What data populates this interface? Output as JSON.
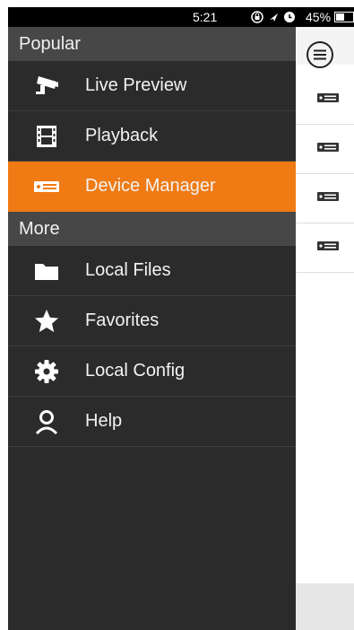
{
  "status_bar": {
    "time": "5:21",
    "battery_percent": "45%",
    "battery_level": 0.45,
    "icons": [
      "lock-rotation-icon",
      "location-arrow-icon",
      "alarm-icon",
      "battery-icon"
    ]
  },
  "drawer": {
    "sections": [
      {
        "header": "Popular",
        "items": [
          {
            "label": "Live Preview",
            "icon": "cctv-camera-icon"
          },
          {
            "label": "Playback",
            "icon": "film-strip-icon"
          },
          {
            "label": "Device Manager",
            "icon": "dvr-device-icon",
            "active": true
          }
        ]
      },
      {
        "header": "More",
        "items": [
          {
            "label": "Local Files",
            "icon": "folder-icon"
          },
          {
            "label": "Favorites",
            "icon": "star-icon"
          },
          {
            "label": "Local Config",
            "icon": "gear-icon"
          },
          {
            "label": "Help",
            "icon": "person-icon"
          }
        ]
      }
    ]
  },
  "main": {
    "menu_icon": "menu-lines-icon",
    "device_rows": 4
  },
  "colors": {
    "accent": "#f07a14",
    "drawer_bg": "#2b2b2b",
    "section_header_bg": "#474747",
    "status_bar_bg": "#000000"
  }
}
